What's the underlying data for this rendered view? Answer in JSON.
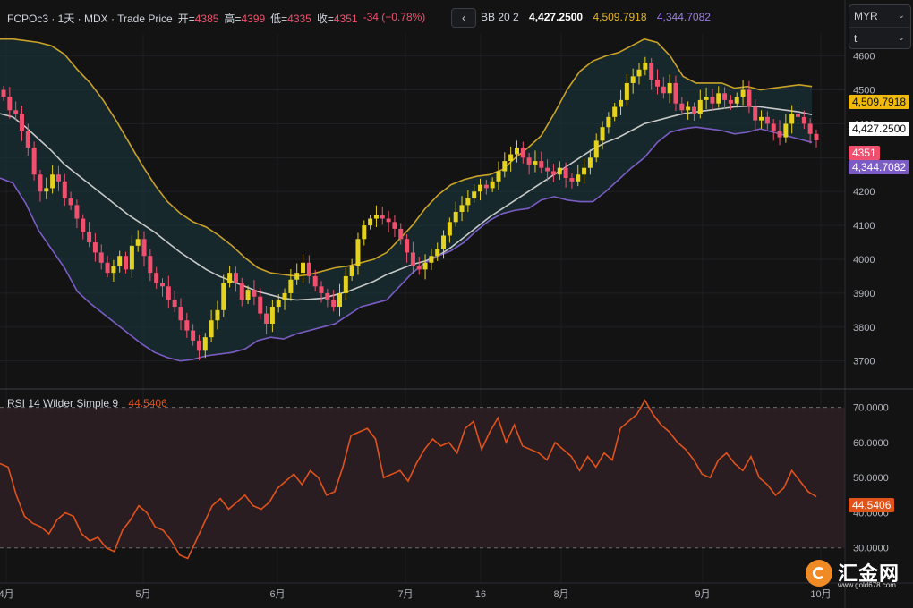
{
  "header": {
    "symbol": "FCPOc3 · 1天 · MDX · Trade Price",
    "open_label": "开=",
    "open": "4385",
    "high_label": "高=",
    "high": "4399",
    "low_label": "低=",
    "low": "4335",
    "close_label": "收=",
    "close": "4351",
    "change": "-34 (−0.78%)"
  },
  "nav_button": "‹",
  "bb": {
    "label": "BB 20 2",
    "mid": "4,427.2500",
    "upper": "4,509.7918",
    "lower": "4,344.7082"
  },
  "rsi": {
    "label": "RSI 14 Wilder Simple 9",
    "value": "44.5406"
  },
  "currency": {
    "selected": "MYR",
    "second": "t"
  },
  "price_tags": {
    "upper": "4,509.7918",
    "mid": "4,427.2500",
    "last": "4351",
    "lower": "4,344.7082",
    "rsi": "44.5406"
  },
  "colors": {
    "up": "#e5d21e",
    "down": "#f0506e",
    "upper_band": "#c9a227",
    "mid_band": "#c8c8c8",
    "lower_band": "#7b5cc4",
    "rsi_line": "#e0531b"
  },
  "logo": {
    "text": "汇金网",
    "url": "www.gold678.com"
  },
  "chart_data": [
    {
      "type": "candlestick",
      "title": "FCPOc3 · 1天 · MDX · Trade Price",
      "x_labels": [
        "4月",
        "5月",
        "6月",
        "7月",
        "16",
        "8月",
        "9月",
        "10月"
      ],
      "y_ticks": [
        3700,
        3800,
        3900,
        4000,
        4100,
        4200,
        4300,
        4400,
        4500,
        4600
      ],
      "ylim": [
        3620,
        4665
      ],
      "closes": [
        4480,
        4440,
        4430,
        4380,
        4330,
        4250,
        4200,
        4210,
        4250,
        4230,
        4180,
        4160,
        4120,
        4080,
        4050,
        4020,
        3990,
        3960,
        3980,
        4010,
        3970,
        4040,
        4060,
        4010,
        3960,
        3930,
        3920,
        3880,
        3860,
        3820,
        3790,
        3760,
        3730,
        3770,
        3820,
        3850,
        3930,
        3960,
        3930,
        3880,
        3910,
        3890,
        3840,
        3810,
        3860,
        3880,
        3900,
        3940,
        3960,
        3990,
        3950,
        3920,
        3900,
        3880,
        3860,
        3900,
        3950,
        3980,
        4060,
        4100,
        4120,
        4130,
        4120,
        4110,
        4090,
        4060,
        4020,
        3980,
        3970,
        3990,
        4010,
        4030,
        4070,
        4110,
        4140,
        4160,
        4180,
        4200,
        4220,
        4210,
        4230,
        4260,
        4290,
        4310,
        4330,
        4300,
        4280,
        4290,
        4270,
        4260,
        4250,
        4270,
        4240,
        4230,
        4250,
        4270,
        4300,
        4350,
        4390,
        4420,
        4450,
        4470,
        4520,
        4540,
        4560,
        4580,
        4530,
        4510,
        4490,
        4520,
        4460,
        4440,
        4450,
        4430,
        4470,
        4480,
        4460,
        4490,
        4470,
        4460,
        4480,
        4500,
        4450,
        4410,
        4420,
        4400,
        4380,
        4360,
        4400,
        4430,
        4420,
        4400,
        4370,
        4351
      ],
      "upper_band": [
        4650,
        4650,
        4645,
        4640,
        4630,
        4605,
        4560,
        4520,
        4470,
        4410,
        4345,
        4280,
        4220,
        4170,
        4135,
        4110,
        4095,
        4070,
        4040,
        4005,
        3975,
        3960,
        3955,
        3950,
        3955,
        3965,
        3975,
        3980,
        3990,
        4000,
        4020,
        4060,
        4100,
        4150,
        4190,
        4220,
        4235,
        4245,
        4250,
        4265,
        4300,
        4330,
        4365,
        4430,
        4500,
        4555,
        4585,
        4600,
        4610,
        4630,
        4650,
        4640,
        4600,
        4540,
        4520,
        4520,
        4520,
        4505,
        4510,
        4500,
        4505,
        4510,
        4515,
        4510
      ],
      "mid_band": [
        4430,
        4420,
        4390,
        4355,
        4320,
        4280,
        4250,
        4220,
        4190,
        4160,
        4130,
        4105,
        4080,
        4050,
        4020,
        3995,
        3970,
        3950,
        3935,
        3920,
        3905,
        3895,
        3885,
        3880,
        3882,
        3885,
        3895,
        3905,
        3920,
        3935,
        3955,
        3970,
        3985,
        3995,
        4010,
        4035,
        4065,
        4095,
        4125,
        4150,
        4175,
        4200,
        4225,
        4250,
        4275,
        4300,
        4325,
        4345,
        4360,
        4380,
        4400,
        4410,
        4420,
        4430,
        4435,
        4440,
        4445,
        4450,
        4452,
        4450,
        4445,
        4440,
        4435,
        4427
      ],
      "lower_band": [
        4240,
        4225,
        4165,
        4085,
        4030,
        3975,
        3905,
        3870,
        3840,
        3810,
        3780,
        3750,
        3725,
        3710,
        3700,
        3705,
        3715,
        3720,
        3725,
        3735,
        3760,
        3770,
        3765,
        3780,
        3790,
        3800,
        3810,
        3835,
        3860,
        3870,
        3880,
        3920,
        3960,
        3990,
        4010,
        4025,
        4050,
        4085,
        4115,
        4135,
        4145,
        4150,
        4175,
        4185,
        4175,
        4170,
        4170,
        4200,
        4235,
        4270,
        4300,
        4345,
        4375,
        4385,
        4390,
        4385,
        4380,
        4370,
        4375,
        4385,
        4375,
        4365,
        4355,
        4345
      ]
    },
    {
      "type": "line",
      "title": "RSI 14 Wilder Simple 9",
      "y_ticks": [
        30,
        40,
        50,
        60,
        70
      ],
      "ylim": [
        20,
        75
      ],
      "levels": [
        70,
        30
      ],
      "values": [
        54,
        53,
        45,
        39,
        37,
        36,
        34,
        38,
        40,
        39,
        34,
        32,
        33,
        30,
        29,
        35,
        38,
        42,
        40,
        36,
        35,
        32,
        28,
        27,
        32,
        37,
        42,
        44,
        41,
        43,
        45,
        42,
        41,
        43,
        47,
        49,
        51,
        48,
        52,
        50,
        45,
        46,
        53,
        62,
        63,
        64,
        61,
        50,
        51,
        52,
        49,
        54,
        58,
        61,
        59,
        60,
        57,
        64,
        66,
        58,
        63,
        67,
        60,
        65,
        59,
        58,
        57,
        55,
        60,
        58,
        56,
        52,
        56,
        53,
        57,
        55,
        64,
        66,
        68,
        72,
        68,
        65,
        63,
        60,
        58,
        55,
        51,
        50,
        55,
        57,
        54,
        52,
        56,
        50,
        48,
        45,
        47,
        52,
        49,
        46,
        44.5406
      ]
    }
  ]
}
